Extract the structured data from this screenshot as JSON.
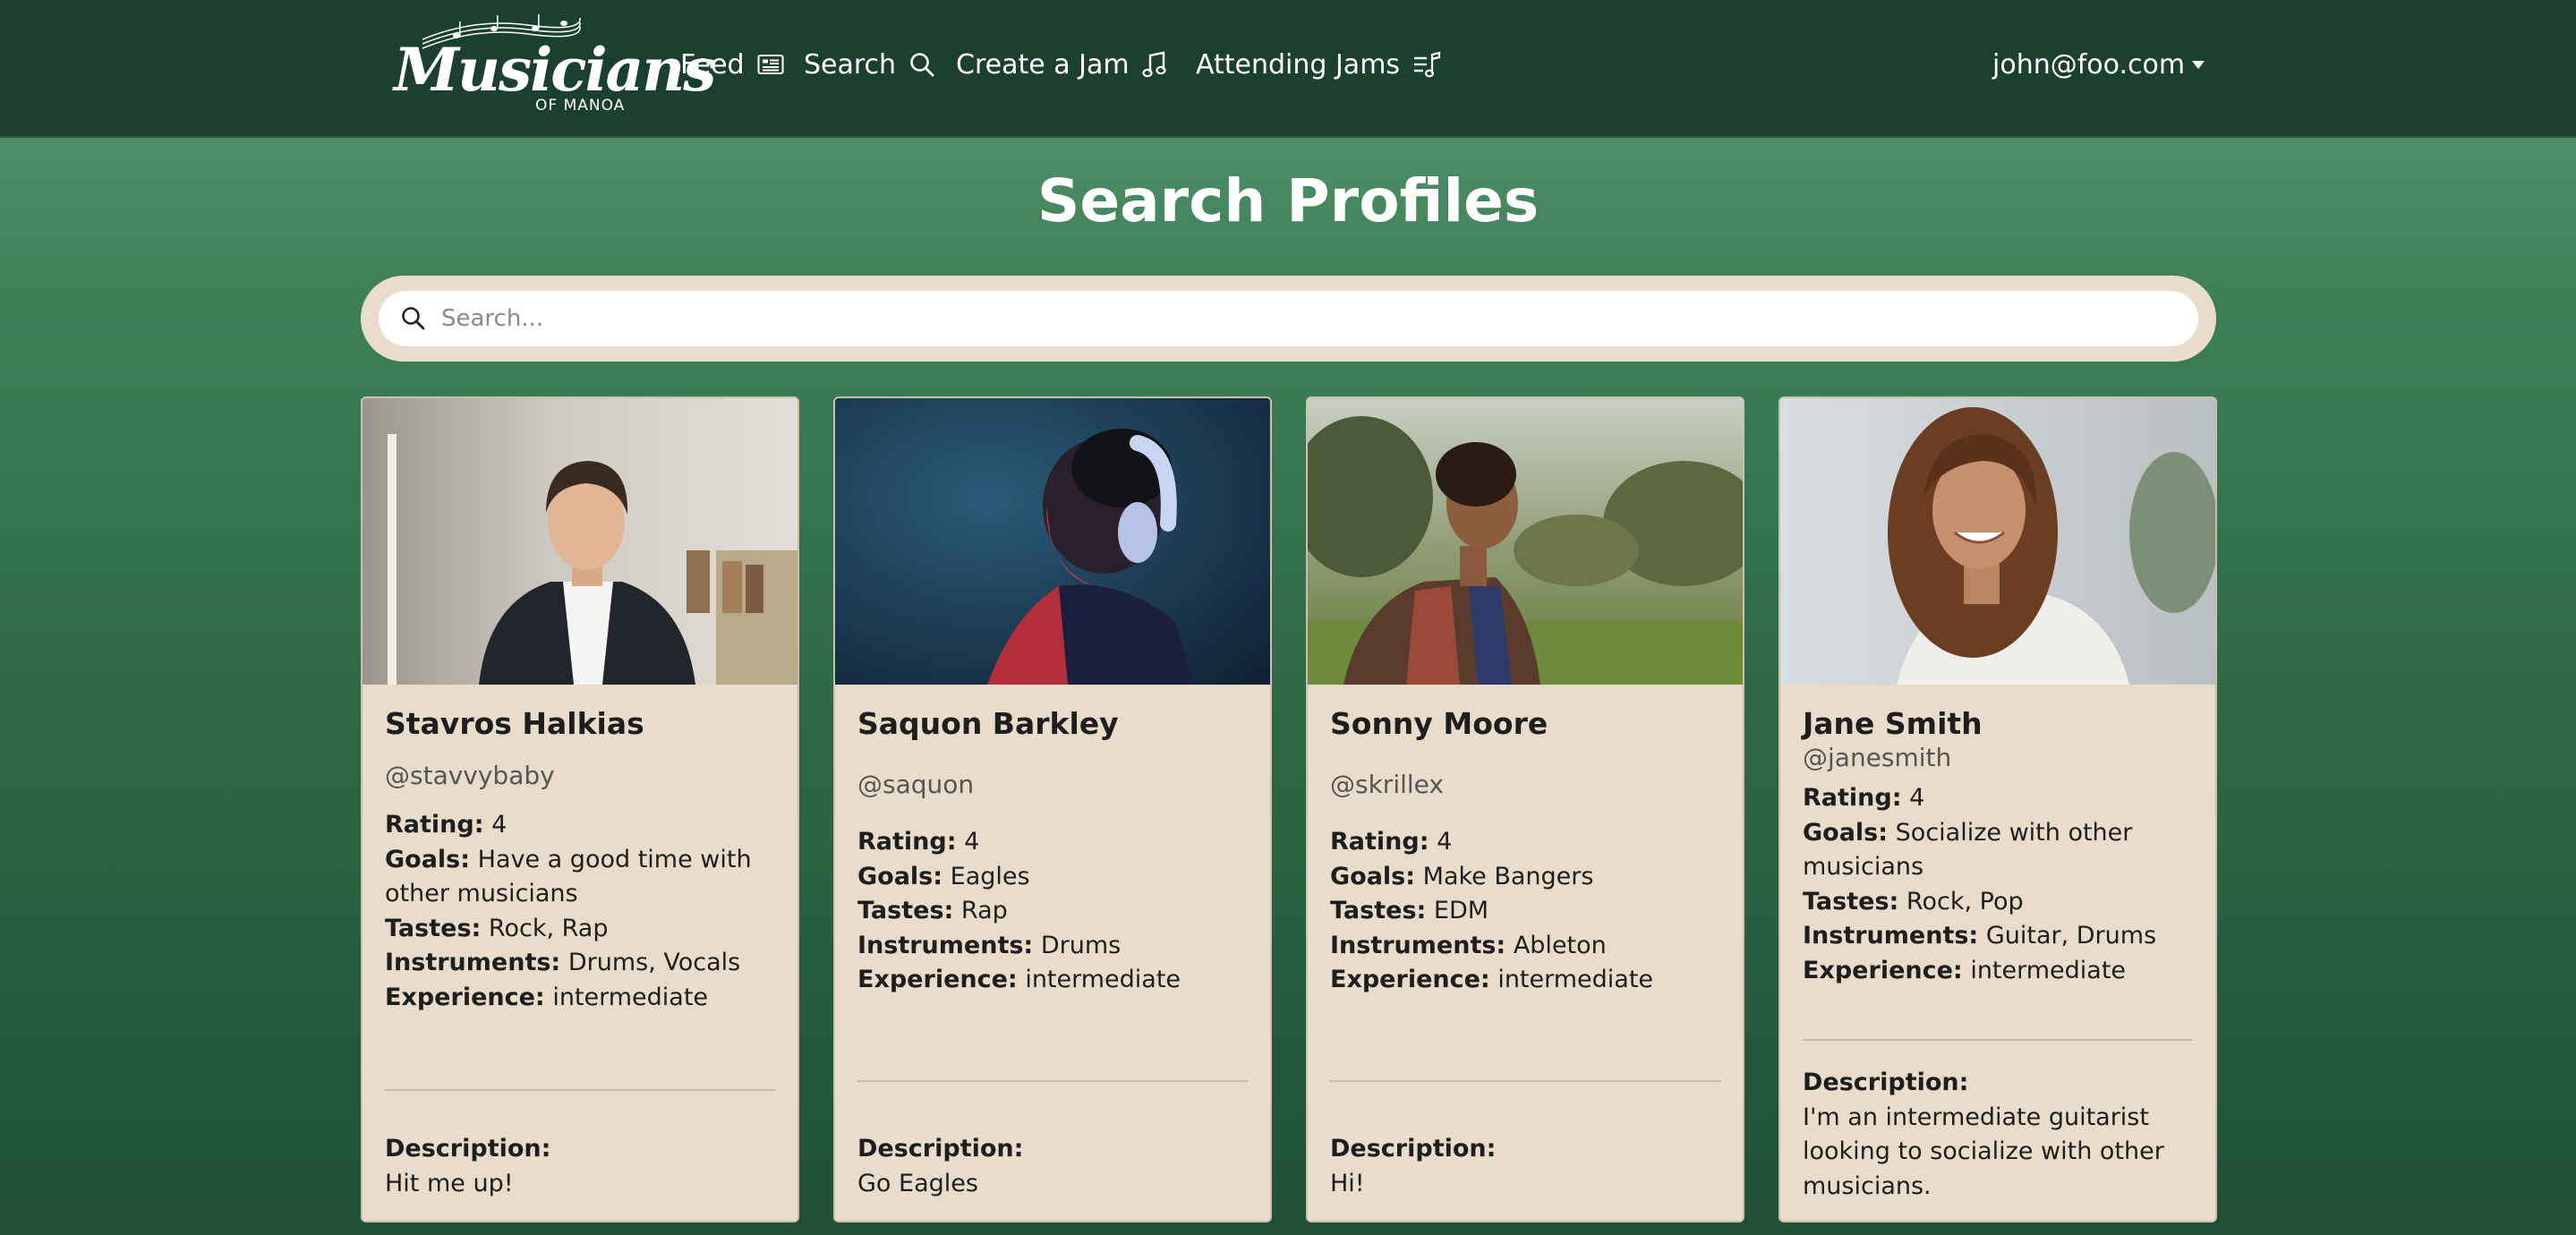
{
  "brand": {
    "name": "Musicians",
    "sub": "OF MANOA"
  },
  "nav": {
    "feed": "Feed",
    "search": "Search",
    "create": "Create a Jam",
    "attending": "Attending Jams"
  },
  "user": {
    "email": "john@foo.com"
  },
  "page": {
    "title": "Search Profiles"
  },
  "search": {
    "placeholder": "Search...",
    "value": ""
  },
  "labels": {
    "rating": "Rating:",
    "goals": "Goals:",
    "tastes": "Tastes:",
    "instruments": "Instruments:",
    "experience": "Experience:",
    "description": "Description:"
  },
  "profiles": [
    {
      "name": "Stavros Halkias",
      "handle": "@stavvybaby",
      "rating": "4",
      "goals": "Have a good time with other musicians",
      "tastes": "Rock, Rap",
      "instruments": "Drums, Vocals",
      "experience": "intermediate",
      "description": "Hit me up!"
    },
    {
      "name": "Saquon Barkley",
      "handle": "@saquon",
      "rating": "4",
      "goals": "Eagles",
      "tastes": "Rap",
      "instruments": "Drums",
      "experience": "intermediate",
      "description": "Go Eagles"
    },
    {
      "name": "Sonny Moore",
      "handle": "@skrillex",
      "rating": "4",
      "goals": "Make Bangers",
      "tastes": "EDM",
      "instruments": "Ableton",
      "experience": "intermediate",
      "description": "Hi!"
    },
    {
      "name": "Jane Smith",
      "handle": "@janesmith",
      "rating": "4",
      "goals": "Socialize with other musicians",
      "tastes": "Rock, Pop",
      "instruments": "Guitar, Drums",
      "experience": "intermediate",
      "description": "I'm an intermediate guitarist looking to socialize with other musicians."
    }
  ],
  "colors": {
    "navbar": "#1c4030",
    "card": "#e9dccb",
    "accent": "#3f8258"
  }
}
